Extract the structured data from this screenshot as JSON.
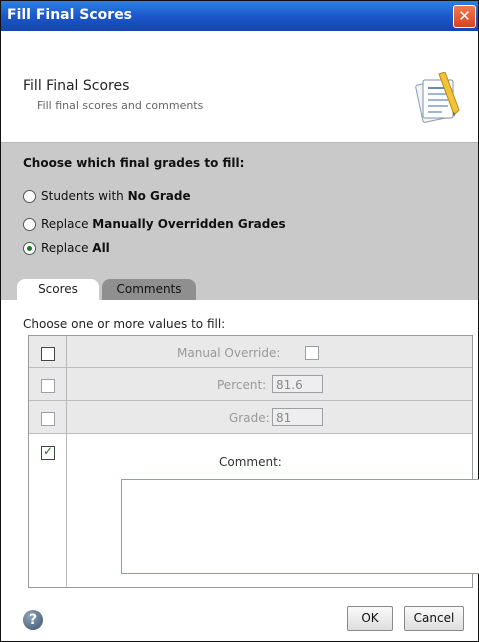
{
  "window": {
    "title": "Fill Final Scores",
    "close_glyph": "✕"
  },
  "header": {
    "title": "Fill Final Scores",
    "subtitle": "Fill final scores and comments",
    "icon": "grades-document-icon"
  },
  "choose": {
    "question": "Choose which final grades to fill:",
    "options": [
      {
        "prefix": "Students with ",
        "bold": "No Grade",
        "selected": false
      },
      {
        "prefix": "Replace ",
        "bold": "Manually Overridden Grades",
        "selected": false
      },
      {
        "prefix": "Replace ",
        "bold": "All",
        "selected": true
      }
    ]
  },
  "tabs": [
    {
      "label": "Scores",
      "active": true
    },
    {
      "label": "Comments",
      "active": false
    }
  ],
  "scores": {
    "instruction": "Choose one or more values to fill:",
    "manual_override": {
      "label": "Manual Override:",
      "row_checked": false,
      "value_checked": false
    },
    "percent": {
      "label": "Percent:",
      "value": "81.6",
      "row_checked": false
    },
    "grade": {
      "label": "Grade:",
      "value": "81",
      "row_checked": false
    },
    "comment": {
      "label": "Comment:",
      "value": "",
      "row_checked": true
    }
  },
  "footer": {
    "help_glyph": "?",
    "ok_label": "OK",
    "cancel_label": "Cancel"
  },
  "colors": {
    "titlebar": "#1a55c8",
    "section_bg": "#c9c9c9",
    "disabled_row_bg": "#e9e9e9",
    "check_green": "#1d6e27"
  }
}
